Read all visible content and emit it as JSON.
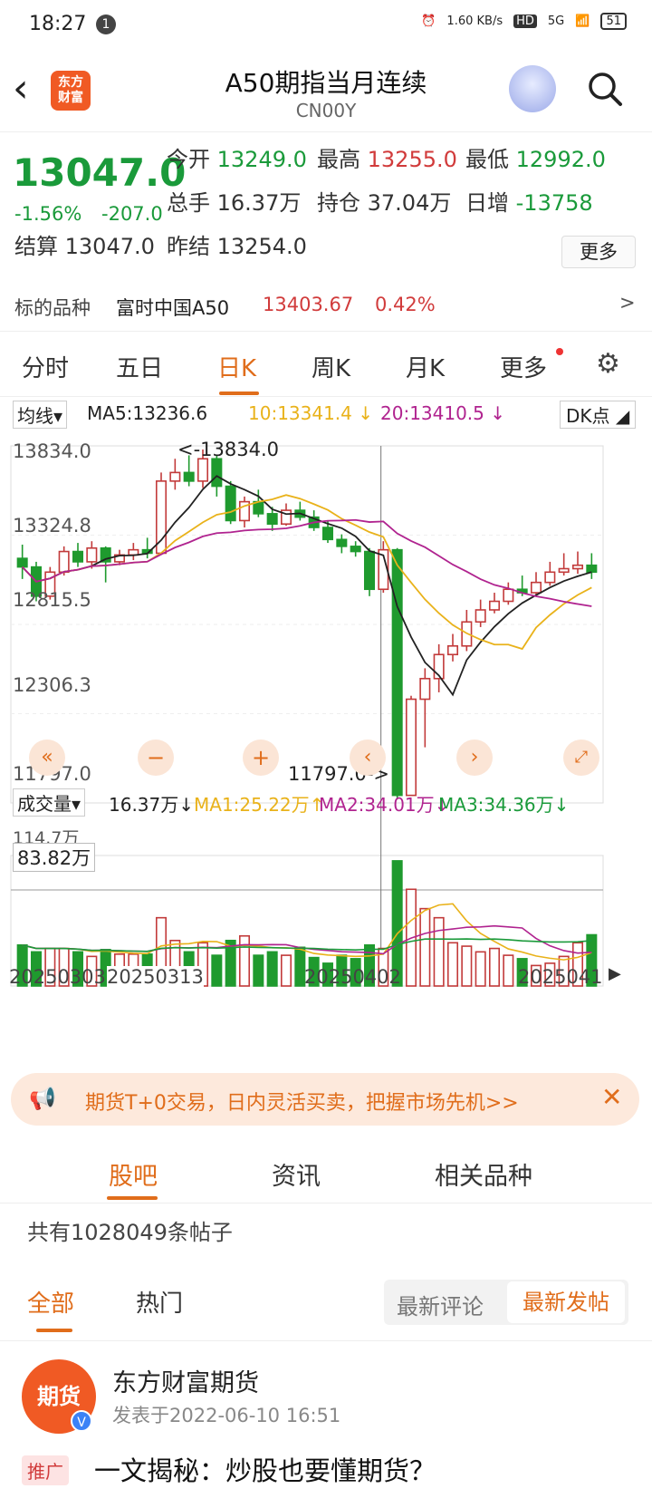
{
  "status": {
    "time": "18:27",
    "notif": "1",
    "speed": "1.60 KB/s",
    "hd": "HD",
    "net": "5G",
    "battery": "51"
  },
  "header": {
    "title": "A50期指当月连续",
    "code": "CN00Y",
    "logo": "东方\n财富"
  },
  "quote": {
    "price": "13047.0",
    "change_pct": "-1.56%",
    "change": "-207.0",
    "open_label": "今开",
    "open": "13249.0",
    "high_label": "最高",
    "high": "13255.0",
    "low_label": "最低",
    "low": "12992.0",
    "vol_label": "总手",
    "vol": "16.37万",
    "oi_label": "持仓",
    "oi": "37.04万",
    "daily_label": "日增",
    "daily": "-13758",
    "settle_label": "结算",
    "settle": "13047.0",
    "prev_label": "昨结",
    "prev": "13254.0",
    "more": "更多"
  },
  "underlying": {
    "label": "标的品种",
    "name": "富时中国A50",
    "price": "13403.67",
    "pct": "0.42%"
  },
  "tabs": [
    "分时",
    "五日",
    "日K",
    "周K",
    "月K",
    "更多"
  ],
  "ma_bar": {
    "sel": "均线",
    "ma5": "MA5:13236.6",
    "ma10": "10:13341.4 ↓",
    "ma20": "20:13410.5 ↓",
    "dk": "DK点"
  },
  "vol_bar": {
    "sel": "成交量",
    "v": "16.37万↓",
    "ma1": "MA1:25.22万↑",
    "ma2": "MA2:34.01万↓",
    "ma3": "MA3:34.36万↓"
  },
  "chart_labels": {
    "y": [
      "13834.0",
      "13324.8",
      "12815.5",
      "12306.3",
      "11797.0"
    ],
    "max_note": "<-13834.0",
    "min_note": "11797.0->",
    "vol_top": "114.7万",
    "vol_mark": "83.82万",
    "dates": [
      "20250303",
      "20250313",
      "20250402",
      "2025041"
    ]
  },
  "chart_data": {
    "type": "candlestick",
    "ylim": [
      11797.0,
      13834.0
    ],
    "candles": [
      [
        13200,
        13150,
        13280,
        13080
      ],
      [
        13150,
        12980,
        13180,
        12950
      ],
      [
        12980,
        13120,
        13150,
        12960
      ],
      [
        13120,
        13240,
        13270,
        13100
      ],
      [
        13240,
        13180,
        13290,
        13150
      ],
      [
        13180,
        13260,
        13300,
        13140
      ],
      [
        13260,
        13180,
        13270,
        13060
      ],
      [
        13180,
        13220,
        13250,
        13160
      ],
      [
        13220,
        13250,
        13290,
        13190
      ],
      [
        13250,
        13230,
        13320,
        13200
      ],
      [
        13230,
        13650,
        13700,
        13220
      ],
      [
        13650,
        13700,
        13780,
        13600
      ],
      [
        13700,
        13650,
        13800,
        13620
      ],
      [
        13650,
        13780,
        13834,
        13610
      ],
      [
        13780,
        13620,
        13800,
        13560
      ],
      [
        13620,
        13420,
        13650,
        13400
      ],
      [
        13420,
        13530,
        13560,
        13380
      ],
      [
        13530,
        13460,
        13600,
        13440
      ],
      [
        13460,
        13400,
        13500,
        13360
      ],
      [
        13400,
        13480,
        13520,
        13390
      ],
      [
        13480,
        13440,
        13530,
        13420
      ],
      [
        13440,
        13380,
        13480,
        13360
      ],
      [
        13380,
        13310,
        13420,
        13290
      ],
      [
        13310,
        13270,
        13340,
        13230
      ],
      [
        13270,
        13240,
        13300,
        13210
      ],
      [
        13240,
        13020,
        13260,
        12980
      ],
      [
        13020,
        13250,
        13300,
        13000
      ],
      [
        13250,
        11820,
        13260,
        11797
      ],
      [
        11820,
        12380,
        12400,
        11850
      ],
      [
        12380,
        12500,
        12560,
        12100
      ],
      [
        12500,
        12640,
        12700,
        12420
      ],
      [
        12640,
        12690,
        12760,
        12600
      ],
      [
        12690,
        12830,
        12900,
        12660
      ],
      [
        12830,
        12900,
        12960,
        12800
      ],
      [
        12900,
        12950,
        13000,
        12880
      ],
      [
        12950,
        13020,
        13060,
        12930
      ],
      [
        13020,
        13000,
        13100,
        12980
      ],
      [
        13000,
        13060,
        13120,
        12990
      ],
      [
        13060,
        13120,
        13180,
        13040
      ],
      [
        13120,
        13140,
        13230,
        13100
      ],
      [
        13140,
        13160,
        13240,
        13110
      ],
      [
        13160,
        13120,
        13230,
        13080
      ]
    ],
    "volume": [
      36,
      30,
      33,
      33,
      30,
      26,
      32,
      28,
      28,
      28,
      60,
      40,
      30,
      38,
      27,
      40,
      44,
      27,
      30,
      27,
      34,
      25,
      20,
      27,
      24,
      36,
      33,
      110,
      85,
      68,
      60,
      38,
      35,
      30,
      33,
      27,
      24,
      18,
      20,
      26,
      38,
      45
    ]
  },
  "banner": {
    "text": "期货T+0交易，日内灵活买卖，把握市场先机>>"
  },
  "bottom_tabs": [
    "股吧",
    "资讯",
    "相关品种"
  ],
  "posts_count": "共有1028049条帖子",
  "sub_tabs": [
    "全部",
    "热门"
  ],
  "seg": [
    "最新评论",
    "最新发帖"
  ],
  "post": {
    "author": "东方财富期货",
    "time": "发表于2022-06-10 16:51",
    "tag": "推广",
    "title": "一文揭秘：炒股也要懂期货？",
    "avatar": "期货"
  }
}
